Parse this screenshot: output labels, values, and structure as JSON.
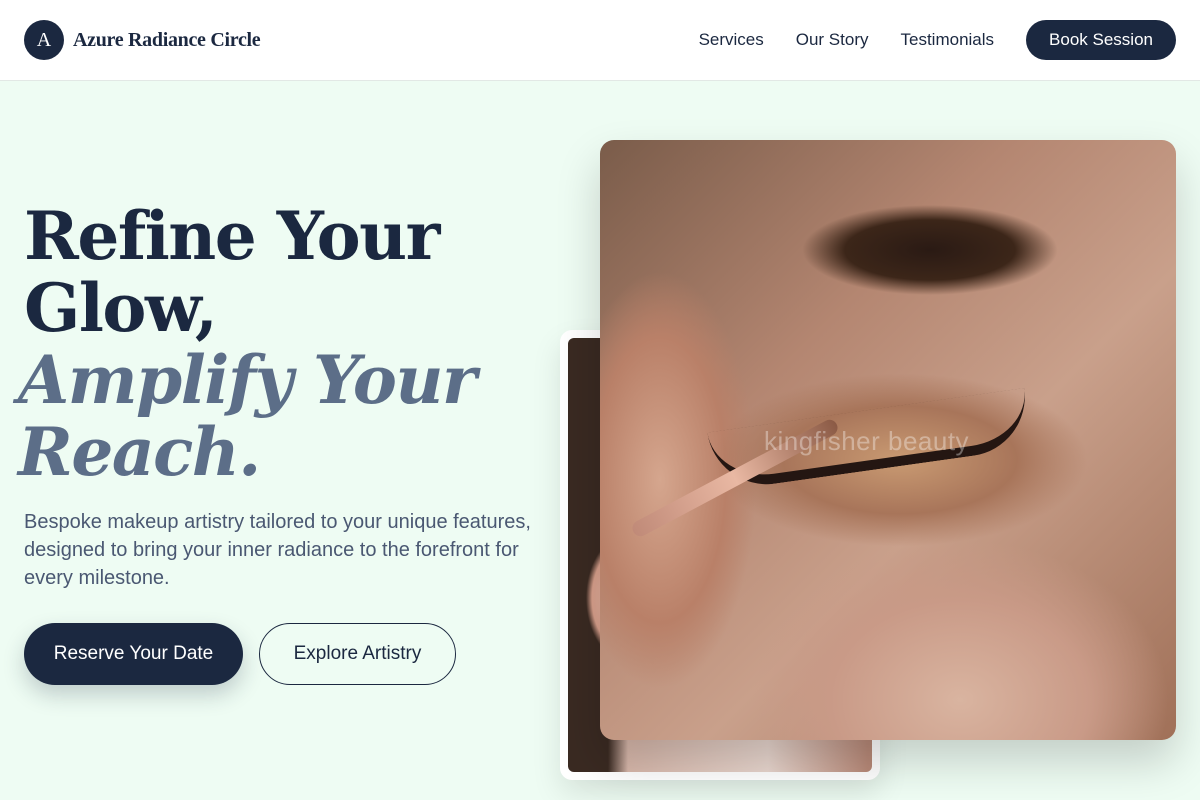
{
  "brand": {
    "logo_letter": "A",
    "name": "Azure Radiance Circle"
  },
  "nav": {
    "items": [
      {
        "label": "Services"
      },
      {
        "label": "Our Story"
      },
      {
        "label": "Testimonials"
      }
    ],
    "cta_label": "Book Session"
  },
  "hero": {
    "title_line1": "Refine Your",
    "title_line2": "Glow,",
    "title_accent_line1": "Amplify Your",
    "title_accent_line2": "Reach.",
    "subtitle": "Bespoke makeup artistry tailored to your unique features, designed to bring your inner radiance to the forefront for every milestone.",
    "primary_button": "Reserve Your Date",
    "secondary_button": "Explore Artistry"
  },
  "images": {
    "main_watermark": "kingfisher beauty"
  },
  "colors": {
    "navy": "#1b2840",
    "accent_slate": "#5c6e88",
    "background_mint": "#eefcf3"
  }
}
